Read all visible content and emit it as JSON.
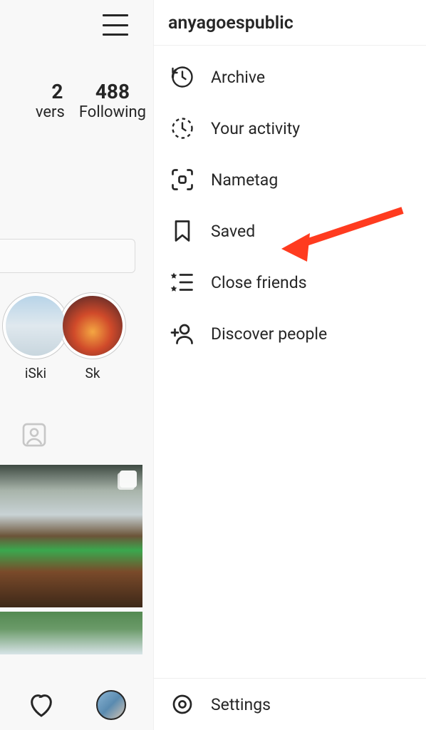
{
  "profile": {
    "followers_count_partial": "2",
    "followers_label_partial": "vers",
    "following_count": "488",
    "following_label": "Following"
  },
  "highlights": [
    {
      "label": "iSki"
    },
    {
      "label": "Sk"
    }
  ],
  "drawer": {
    "username": "anyagoespublic",
    "items": [
      {
        "icon": "archive",
        "label": "Archive"
      },
      {
        "icon": "activity",
        "label": "Your activity"
      },
      {
        "icon": "nametag",
        "label": "Nametag"
      },
      {
        "icon": "saved",
        "label": "Saved"
      },
      {
        "icon": "close-friends",
        "label": "Close friends"
      },
      {
        "icon": "discover",
        "label": "Discover people"
      }
    ],
    "footer": {
      "icon": "settings",
      "label": "Settings"
    }
  },
  "annotation": {
    "color": "#ff3b1f"
  }
}
